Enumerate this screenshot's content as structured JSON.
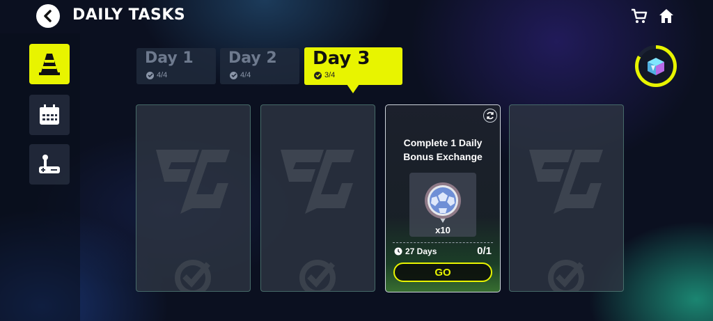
{
  "header": {
    "title": "DAILY TASKS",
    "back_icon": "chevron-left-icon",
    "cart_icon": "shopping-cart-icon",
    "home_icon": "home-icon"
  },
  "sidebar": {
    "items": [
      {
        "icon": "traffic-cone-icon",
        "active": true
      },
      {
        "icon": "calendar-icon",
        "active": false
      },
      {
        "icon": "joystick-icon",
        "active": false
      }
    ]
  },
  "tabs": [
    {
      "label": "Day 1",
      "progress": "4/4",
      "active": false
    },
    {
      "label": "Day 2",
      "progress": "4/4",
      "active": false
    },
    {
      "label": "Day 3",
      "progress": "3/4",
      "active": true
    }
  ],
  "task": {
    "title_line1": "Complete 1 Daily",
    "title_line2": "Bonus Exchange",
    "reward_qty": "x10",
    "reward_icon": "football-icon",
    "days_left": "27 Days",
    "progress": "0/1",
    "go_label": "GO"
  },
  "colors": {
    "accent": "#e8f400",
    "background": "#0b1020"
  }
}
